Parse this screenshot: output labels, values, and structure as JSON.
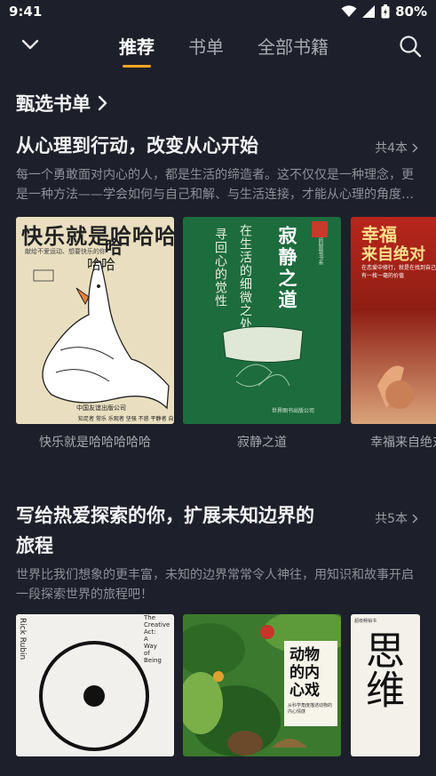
{
  "status": {
    "time": "9:41",
    "battery": "80%"
  },
  "nav": {
    "tabs": [
      {
        "label": "推荐",
        "active": true
      },
      {
        "label": "书单",
        "active": false
      },
      {
        "label": "全部书籍",
        "active": false
      }
    ]
  },
  "section": {
    "title": "甄选书单"
  },
  "lists": [
    {
      "title": "从心理到行动，改变从心开始",
      "count": "共4本",
      "desc_lines": [
        "每一个勇敢面对内心的人，都是生活的缔造者。这不仅仅是一种理念，更",
        "是一种方法——学会如何与自己和解、与生活连接，才能从心理的角度…"
      ],
      "books": [
        {
          "title": "快乐就是哈哈哈哈哈",
          "cover": {
            "headline": "快乐就是哈哈哈",
            "line1": "献给不爱运动、想要快乐的你",
            "publisher": "中国友谊出版公司",
            "tagline": "知足者 常乐 乐观者 坚强 不惑 平静者 自由"
          }
        },
        {
          "title": "寂静之道",
          "cover": {
            "vtext1": "在生活的细微之处",
            "vtext2": "寻回心的觉性",
            "main": "寂静之道",
            "series": "生活的智慧书系",
            "publisher": "世界图书出版公司"
          }
        },
        {
          "title": "幸福来自绝对",
          "cover": {
            "headline1": "幸福",
            "headline2": "来自绝对",
            "sub1": "在恋爱中修行，就是在找到自己的同时，",
            "sub2": "有一枚一毫的价值"
          }
        }
      ]
    },
    {
      "title_line1": "写给热爱探索的你，扩展未知边界的",
      "title_line2": "旅程",
      "count": "共5本",
      "desc_lines": [
        "世界比我们想象的更丰富，未知的边界常常令人神往，用知识和故事开启",
        "一段探索世界的旅程吧！"
      ],
      "books": [
        {
          "cover": {
            "author": "Rick Rubin",
            "title_lines": [
              "The",
              "Creative",
              "Act:",
              "A",
              "Way",
              "of",
              "Being"
            ]
          }
        },
        {
          "cover": {
            "title_lines": [
              "动物",
              "的内",
              "心戏"
            ],
            "sub": "从科学角度描述动物的内心情感"
          }
        },
        {
          "cover": {
            "top": "超级畅销书",
            "main": "思维"
          }
        }
      ]
    }
  ],
  "colors": {
    "background": "#1d202a",
    "accent": "#f5a623"
  },
  "icons": [
    "chevron-down-icon",
    "search-icon",
    "chevron-right-icon",
    "wifi-icon",
    "signal-icon",
    "battery-icon"
  ]
}
